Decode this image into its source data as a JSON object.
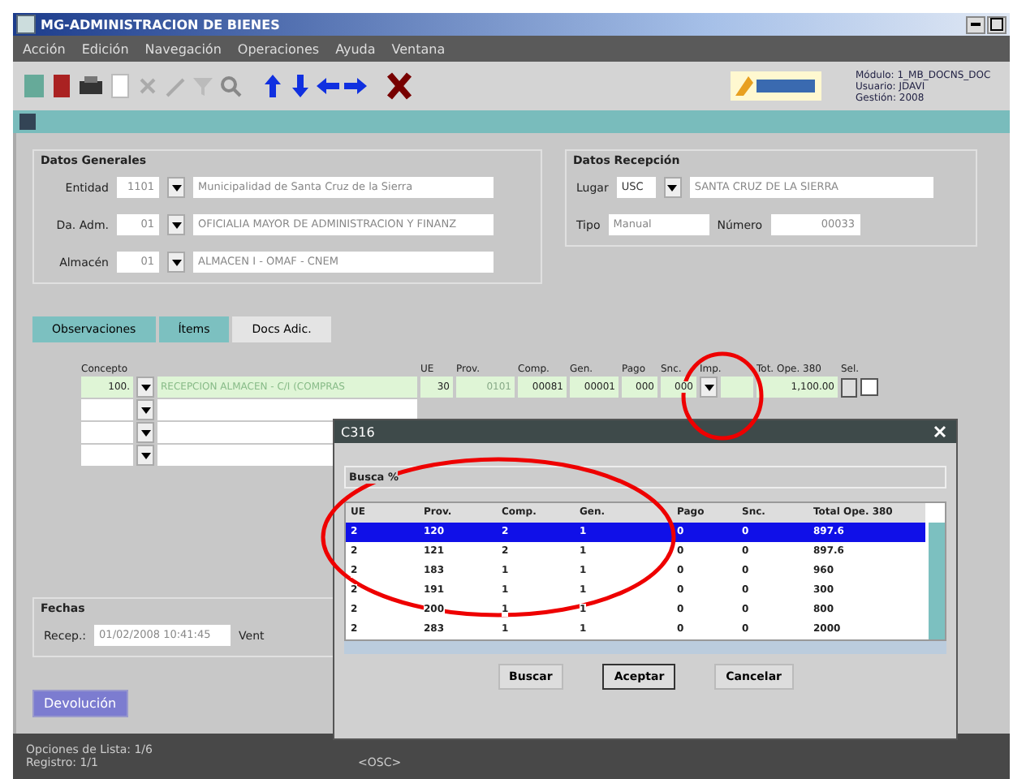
{
  "window": {
    "title": "MG-ADMINISTRACION DE BIENES"
  },
  "menu": [
    "Acción",
    "Edición",
    "Navegación",
    "Operaciones",
    "Ayuda",
    "Ventana"
  ],
  "session_info": [
    "Módulo: 1_MB_DOCNS_DOC",
    "Usuario: JDAVI",
    "Gestión: 2008"
  ],
  "datos_generales": {
    "title": "Datos Generales",
    "rows": [
      {
        "label": "Entidad",
        "code": "1101",
        "name": "Municipalidad de Santa Cruz de la Sierra"
      },
      {
        "label": "Da. Adm.",
        "code": "01",
        "name": "OFICIALIA MAYOR DE ADMINISTRACION Y FINANZ"
      },
      {
        "label": "Almacén",
        "code": "01",
        "name": "ALMACEN I - OMAF - CNEM"
      }
    ]
  },
  "datos_recepcion": {
    "title": "Datos Recepción",
    "lugar_label": "Lugar",
    "lugar_code": "USC",
    "lugar_name": "SANTA CRUZ DE LA SIERRA",
    "tipo_label": "Tipo",
    "tipo": "Manual",
    "numero_label": "Número",
    "numero": "00033"
  },
  "tabs": [
    {
      "label": "Observaciones",
      "selected": false
    },
    {
      "label": "Ítems",
      "selected": false
    },
    {
      "label": "Docs Adic.",
      "selected": true
    }
  ],
  "items": {
    "columns": [
      "Concepto",
      "UE",
      "Prov.",
      "Comp.",
      "Gen.",
      "Pago",
      "Snc.",
      "Imp.",
      "Tot. Ope. 380",
      "Sel."
    ],
    "row": {
      "concepto": "100.",
      "descripcion": "RECEPCION ALMACEN - C/I (COMPRAS",
      "ue": "30",
      "prov": "0101",
      "comp": "00081",
      "gen": "00001",
      "pago": "000",
      "snc": "000",
      "total": "1,100.00",
      "sel": false
    }
  },
  "fechas": {
    "title": "Fechas",
    "recep_label": "Recep.:",
    "recep": "01/02/2008 10:41:45",
    "vent_label": "Vent"
  },
  "devolver_button": "Devolución",
  "status": [
    "Opciones de Lista: 1/6",
    "Registro: 1/1"
  ],
  "status_mode": "<OSC>",
  "dialog": {
    "title": "C316",
    "search_label": "Busca %",
    "columns": [
      "UE",
      "Prov.",
      "Comp.",
      "Gen.",
      "Pago",
      "Snc.",
      "Total Ope. 380"
    ],
    "rows": [
      {
        "cells": [
          "2",
          "120",
          "2",
          "1",
          "0",
          "0",
          "897.6"
        ],
        "selected": true
      },
      {
        "cells": [
          "2",
          "121",
          "2",
          "1",
          "0",
          "0",
          "897.6"
        ],
        "selected": false
      },
      {
        "cells": [
          "2",
          "183",
          "1",
          "1",
          "0",
          "0",
          "960"
        ],
        "selected": false
      },
      {
        "cells": [
          "2",
          "191",
          "1",
          "1",
          "0",
          "0",
          "300"
        ],
        "selected": false
      },
      {
        "cells": [
          "2",
          "200",
          "1",
          "1",
          "0",
          "0",
          "800"
        ],
        "selected": false
      },
      {
        "cells": [
          "2",
          "283",
          "1",
          "1",
          "0",
          "0",
          "2000"
        ],
        "selected": false
      }
    ],
    "buttons": [
      "Buscar",
      "Aceptar",
      "Cancelar"
    ]
  }
}
